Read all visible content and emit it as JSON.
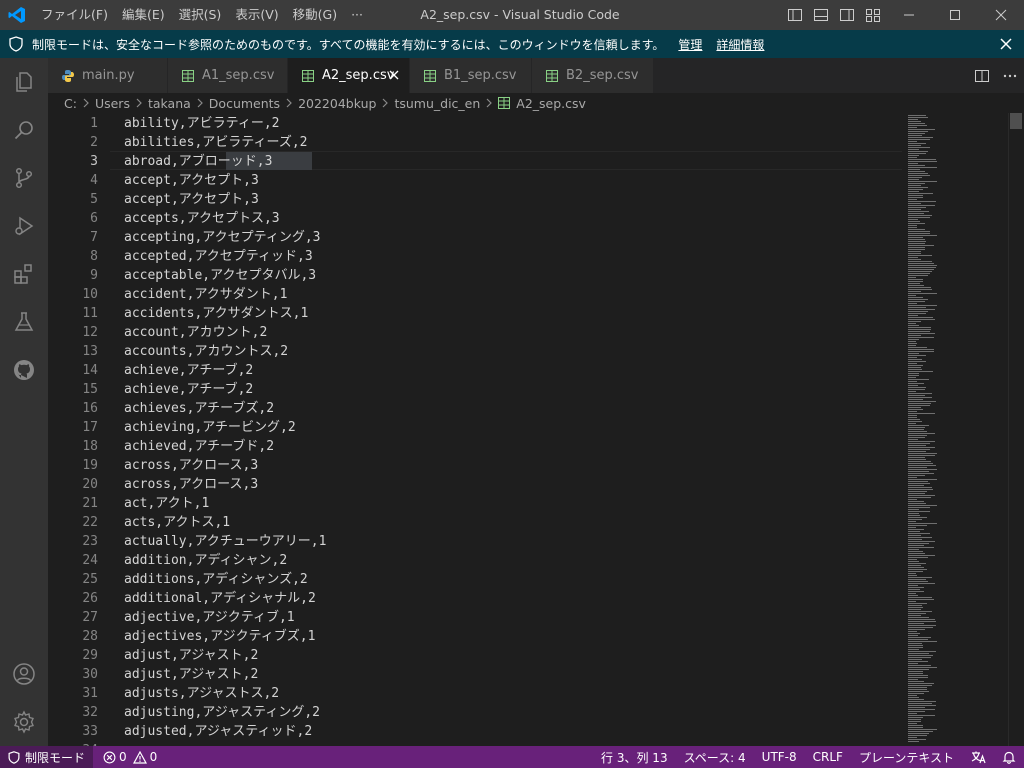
{
  "titlebar": {
    "menu": [
      "ファイル(F)",
      "編集(E)",
      "選択(S)",
      "表示(V)",
      "移動(G)",
      "···"
    ],
    "title": "A2_sep.csv - Visual Studio Code"
  },
  "banner": {
    "text": "制限モードは、安全なコード参照のためのものです。すべての機能を有効にするには、このウィンドウを信頼します。",
    "manage": "管理",
    "details": "詳細情報"
  },
  "tabs": [
    {
      "label": "main.py",
      "icon": "python-icon"
    },
    {
      "label": "A1_sep.csv",
      "icon": "csv-icon"
    },
    {
      "label": "A2_sep.csv",
      "icon": "csv-icon"
    },
    {
      "label": "B1_sep.csv",
      "icon": "csv-icon"
    },
    {
      "label": "B2_sep.csv",
      "icon": "csv-icon"
    }
  ],
  "breadcrumb": [
    "C:",
    "Users",
    "takana",
    "Documents",
    "202204bkup",
    "tsumu_dic_en",
    "A2_sep.csv"
  ],
  "editor": {
    "current_line": 3,
    "lines": [
      {
        "n": "1",
        "text": "ability,アビラティー,2"
      },
      {
        "n": "2",
        "text": "abilities,アビラティーズ,2"
      },
      {
        "n": "3",
        "text": "abroad,アブローッド,3"
      },
      {
        "n": "4",
        "text": "accept,アクセプト,3"
      },
      {
        "n": "5",
        "text": "accept,アクセプト,3"
      },
      {
        "n": "6",
        "text": "accepts,アクセプトス,3"
      },
      {
        "n": "7",
        "text": "accepting,アクセプティング,3"
      },
      {
        "n": "8",
        "text": "accepted,アクセプティッド,3"
      },
      {
        "n": "9",
        "text": "acceptable,アクセプタバル,3"
      },
      {
        "n": "10",
        "text": "accident,アクサダント,1"
      },
      {
        "n": "11",
        "text": "accidents,アクサダントス,1"
      },
      {
        "n": "12",
        "text": "account,アカウント,2"
      },
      {
        "n": "13",
        "text": "accounts,アカウントス,2"
      },
      {
        "n": "14",
        "text": "achieve,アチーブ,2"
      },
      {
        "n": "15",
        "text": "achieve,アチーブ,2"
      },
      {
        "n": "16",
        "text": "achieves,アチーブズ,2"
      },
      {
        "n": "17",
        "text": "achieving,アチービング,2"
      },
      {
        "n": "18",
        "text": "achieved,アチーブド,2"
      },
      {
        "n": "19",
        "text": "across,アクロース,3"
      },
      {
        "n": "20",
        "text": "across,アクロース,3"
      },
      {
        "n": "21",
        "text": "act,アクト,1"
      },
      {
        "n": "22",
        "text": "acts,アクトス,1"
      },
      {
        "n": "23",
        "text": "actually,アクチューウアリー,1"
      },
      {
        "n": "24",
        "text": "addition,アディシャン,2"
      },
      {
        "n": "25",
        "text": "additions,アディシャンズ,2"
      },
      {
        "n": "26",
        "text": "additional,アディシャナル,2"
      },
      {
        "n": "27",
        "text": "adjective,アジクティブ,1"
      },
      {
        "n": "28",
        "text": "adjectives,アジクティブズ,1"
      },
      {
        "n": "29",
        "text": "adjust,アジャスト,2"
      },
      {
        "n": "30",
        "text": "adjust,アジャスト,2"
      },
      {
        "n": "31",
        "text": "adjusts,アジャストス,2"
      },
      {
        "n": "32",
        "text": "adjusting,アジャスティング,2"
      },
      {
        "n": "33",
        "text": "adjusted,アジャスティッド,2"
      },
      {
        "n": "34",
        "text": ""
      }
    ]
  },
  "statusbar": {
    "restricted": "制限モード",
    "errors": "0",
    "warnings": "0",
    "position": "行 3、列 13",
    "spaces": "スペース: 4",
    "encoding": "UTF-8",
    "eol": "CRLF",
    "language": "プレーンテキスト"
  },
  "colors": {
    "titlebar": "#3c3c3c",
    "banner": "#063b49",
    "activitybar": "#333333",
    "statusbar": "#68217a",
    "editor": "#1e1e1e",
    "csv_icon": "#89d185",
    "vscode_logo": "#0098ff"
  }
}
